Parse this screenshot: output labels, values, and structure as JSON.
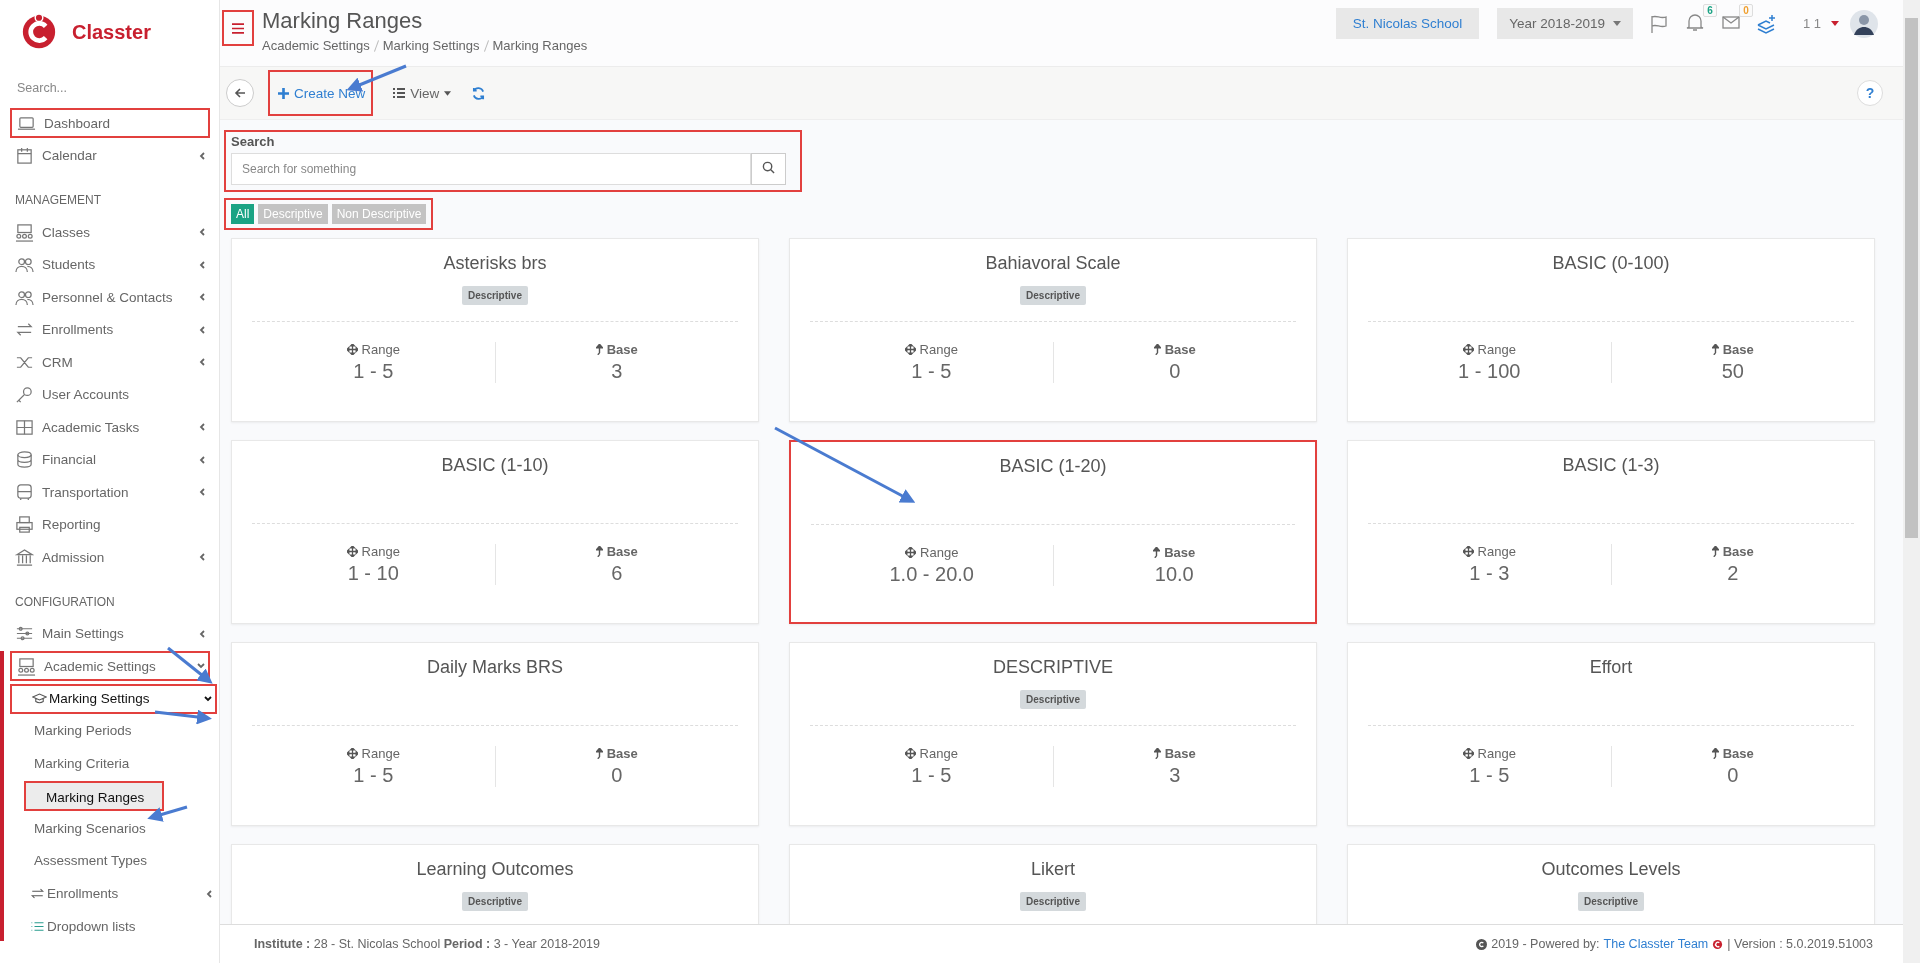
{
  "sidebar": {
    "logo_text": "Classter",
    "search_placeholder": "Search...",
    "sections": [
      {
        "items": [
          {
            "label": "Dashboard",
            "selected": false,
            "highlighted": true
          },
          {
            "label": "Calendar",
            "selected": false,
            "highlighted": false,
            "expanded": false
          }
        ]
      },
      {
        "heading": "MANAGEMENT",
        "items": [
          {
            "label": "Classes",
            "selected": false,
            "highlighted": false,
            "expanded": false
          },
          {
            "label": "Students",
            "selected": false,
            "highlighted": false,
            "expanded": false
          },
          {
            "label": "Personnel & Contacts",
            "selected": false,
            "highlighted": false,
            "expanded": false
          },
          {
            "label": "Enrollments",
            "selected": false,
            "highlighted": false,
            "expanded": false
          },
          {
            "label": "CRM",
            "selected": false,
            "highlighted": false,
            "expanded": false
          },
          {
            "label": "User Accounts",
            "selected": false,
            "highlighted": false
          },
          {
            "label": "Academic Tasks",
            "selected": false,
            "highlighted": false,
            "expanded": false
          },
          {
            "label": "Financial",
            "selected": false,
            "highlighted": false,
            "expanded": false
          },
          {
            "label": "Transportation",
            "selected": false,
            "highlighted": false,
            "expanded": false
          },
          {
            "label": "Reporting",
            "selected": false,
            "highlighted": false
          },
          {
            "label": "Admission",
            "selected": false,
            "highlighted": false,
            "expanded": false
          }
        ]
      },
      {
        "heading": "CONFIGURATION",
        "items": [
          {
            "label": "Main Settings",
            "selected": false,
            "highlighted": false,
            "expanded": false
          },
          {
            "label": "Academic Settings",
            "selected": false,
            "highlighted": true,
            "expanded": true,
            "children": [
              {
                "label": "Marking Settings",
                "selected": false,
                "highlighted": true,
                "expanded": true,
                "children": [
                  {
                    "label": "Marking Periods",
                    "selected": false,
                    "highlighted": false
                  },
                  {
                    "label": "Marking Criteria",
                    "selected": false,
                    "highlighted": false
                  },
                  {
                    "label": "Marking Ranges",
                    "selected": true,
                    "highlighted": true
                  },
                  {
                    "label": "Marking Scenarios",
                    "selected": false,
                    "highlighted": false
                  },
                  {
                    "label": "Assessment Types",
                    "selected": false,
                    "highlighted": false
                  }
                ]
              },
              {
                "label": "Enrollments",
                "selected": false,
                "highlighted": false,
                "expanded": false
              },
              {
                "label": "Dropdown lists",
                "selected": false,
                "highlighted": false
              }
            ]
          }
        ]
      }
    ]
  },
  "header": {
    "menu_highlighted": true,
    "title": "Marking Ranges",
    "breadcrumbs": [
      "Academic Settings",
      "Marking Settings",
      "Marking Ranges"
    ],
    "school": "St. Nicolas School",
    "year": "Year 2018-2019",
    "notifications": "6",
    "messages": "0",
    "user": "1 1"
  },
  "toolbar": {
    "create_label": "Create New",
    "create_highlighted": true,
    "view_label": "View",
    "help": "?"
  },
  "search": {
    "label": "Search",
    "placeholder": "Search for something",
    "highlighted": true
  },
  "filters": {
    "highlighted": true,
    "items": [
      {
        "label": "All",
        "selected": true
      },
      {
        "label": "Descriptive",
        "selected": false
      },
      {
        "label": "Non Descriptive",
        "selected": false
      }
    ]
  },
  "cards": [
    {
      "title": "Asterisks brs",
      "tag": "Descriptive",
      "range_label": "Range",
      "range": "1 - 5",
      "base_label": "Base",
      "base": "3",
      "highlighted": false
    },
    {
      "title": "Bahiavoral Scale",
      "tag": "Descriptive",
      "range_label": "Range",
      "range": "1 - 5",
      "base_label": "Base",
      "base": "0",
      "highlighted": false
    },
    {
      "title": "BASIC (0-100)",
      "range_label": "Range",
      "range": "1 - 100",
      "base_label": "Base",
      "base": "50",
      "highlighted": false
    },
    {
      "title": "BASIC (1-10)",
      "range_label": "Range",
      "range": "1 - 10",
      "base_label": "Base",
      "base": "6",
      "highlighted": false
    },
    {
      "title": "BASIC (1-20)",
      "range_label": "Range",
      "range": "1.0 - 20.0",
      "base_label": "Base",
      "base": "10.0",
      "highlighted": true
    },
    {
      "title": "BASIC (1-3)",
      "range_label": "Range",
      "range": "1 - 3",
      "base_label": "Base",
      "base": "2",
      "highlighted": false
    },
    {
      "title": "Daily Marks BRS",
      "range_label": "Range",
      "range": "1 - 5",
      "base_label": "Base",
      "base": "0",
      "highlighted": false
    },
    {
      "title": "DESCRIPTIVE",
      "tag": "Descriptive",
      "range_label": "Range",
      "range": "1 - 5",
      "base_label": "Base",
      "base": "3",
      "highlighted": false
    },
    {
      "title": "Effort",
      "range_label": "Range",
      "range": "1 - 5",
      "base_label": "Base",
      "base": "0",
      "highlighted": false
    },
    {
      "title": "Learning Outcomes",
      "tag": "Descriptive",
      "highlighted": false
    },
    {
      "title": "Likert",
      "tag": "Descriptive",
      "highlighted": false
    },
    {
      "title": "Outcomes Levels",
      "tag": "Descriptive",
      "highlighted": false
    }
  ],
  "footer": {
    "info": "**Institute :** 28 - St. Nicolas School **Period :** 3 - Year 2018-2019",
    "powered": "2019 - Powered by:",
    "team_link": "The Classter Team",
    "version": "| Version : 5.0.2019.51003"
  }
}
